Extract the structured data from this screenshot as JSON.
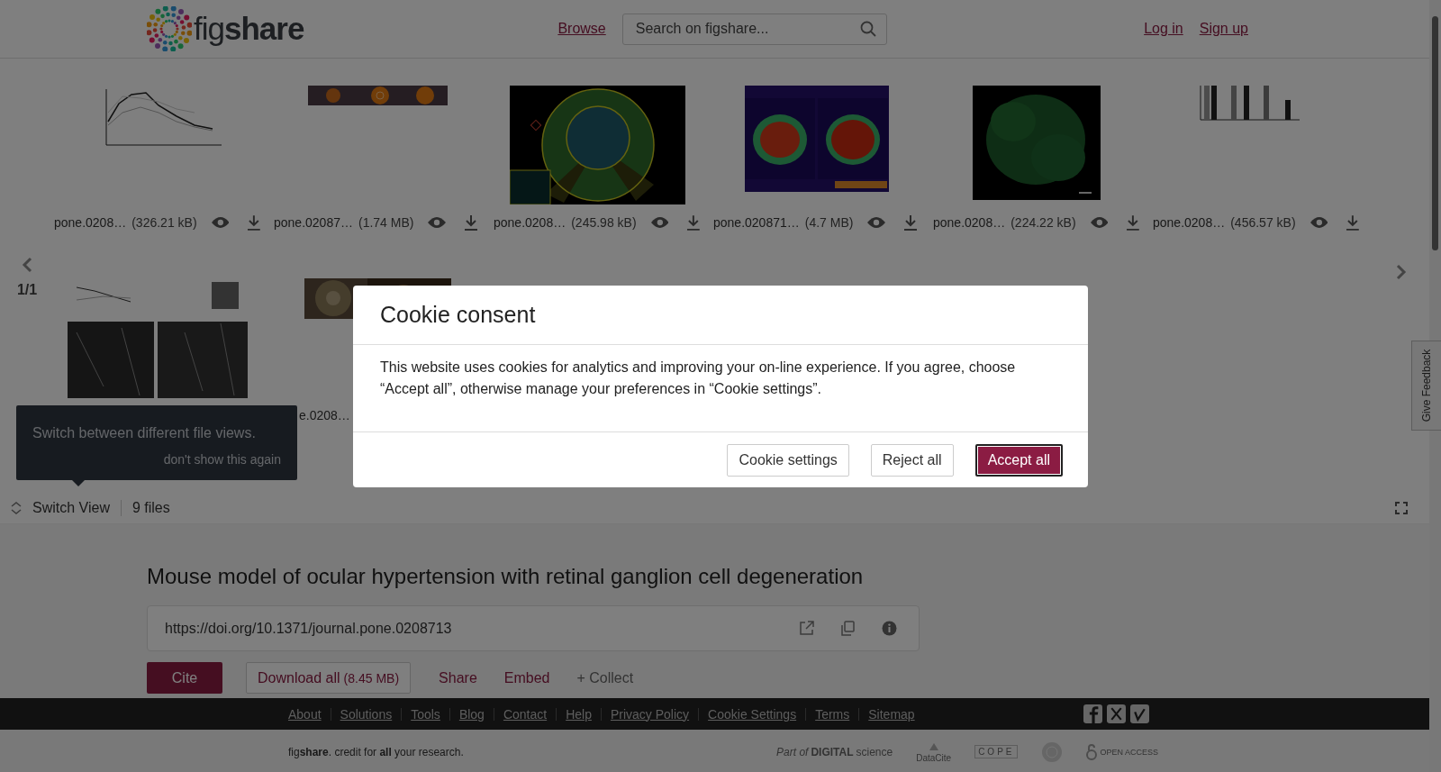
{
  "header": {
    "logo": "fig**share**",
    "nav_link": "Browse",
    "search": {
      "placeholder": "Search on figshare..."
    },
    "links": [
      "Log in",
      "Sign up"
    ]
  },
  "gallery": {
    "page": "1/1",
    "rows": [
      {
        "files": [
          {
            "kind": "picture",
            "name": "pone.0208…",
            "size": "(326.21 kB)"
          },
          {
            "kind": "picture",
            "name": "pone.02087…",
            "size": "(1.74 MB)"
          },
          {
            "kind": "picture",
            "name": "pone.0208…",
            "size": "(245.98 kB)"
          },
          {
            "kind": "picture",
            "name": "pone.020871…",
            "size": "(4.7 MB)"
          },
          {
            "kind": "picture",
            "name": "pone.0208…",
            "size": "(224.22 kB)"
          },
          {
            "kind": "picture",
            "name": "pone.0208…",
            "size": "(456.57 kB)"
          }
        ]
      },
      {
        "files": [
          {
            "kind": "picture"
          },
          {
            "kind": "picture",
            "name": "e.0208…"
          }
        ]
      }
    ]
  },
  "tooltip": {
    "text": "Switch between different file views.",
    "dismiss": "don't show this again"
  },
  "switch_bar": {
    "label": "Switch View",
    "file_count": "9 files"
  },
  "item": {
    "title": "Mouse model of ocular hypertension with retinal ganglion cell degeneration",
    "doi": "https://doi.org/10.1371/journal.pone.0208713",
    "actions": [
      {
        "kind": "primary",
        "label": "Cite"
      },
      {
        "kind": "outlined",
        "label": "Download all",
        "note": "(8.45 MB)"
      },
      {
        "kind": "link",
        "label": "Share"
      },
      {
        "kind": "link",
        "label": "Embed"
      },
      {
        "kind": "muted",
        "label": "+ Collect"
      }
    ]
  },
  "footer": {
    "links": [
      "About",
      "Solutions",
      "Tools",
      "Blog",
      "Contact",
      "Help",
      "Privacy Policy",
      "Cookie Settings",
      "Terms",
      "Sitemap"
    ],
    "social": [
      {
        "kind": "facebook"
      },
      {
        "kind": "x"
      },
      {
        "kind": "vimeo"
      }
    ],
    "tagline": "fig**share**. credit for **all** your research.",
    "partners": [
      {
        "kind": "digital-science",
        "label": "*Part of* **DIGITAL**science"
      },
      {
        "kind": "datacite",
        "label": "DataCite"
      },
      {
        "kind": "cope",
        "label": "COPE"
      },
      {
        "kind": "emblem"
      },
      {
        "kind": "open-access",
        "label": "OPEN ACCESS"
      }
    ]
  },
  "feedback": "Give Feedback",
  "cookie_modal": {
    "title": "Cookie consent",
    "body": "This website uses cookies for analytics and improving your on-line experience. If you agree, choose “Accept all”, otherwise manage your preferences in “Cookie settings”.",
    "buttons": [
      {
        "kind": "secondary",
        "label": "Cookie settings",
        "focused": false
      },
      {
        "kind": "secondary",
        "label": "Reject all",
        "focused": false
      },
      {
        "kind": "primary",
        "label": "Accept all",
        "focused": true
      }
    ]
  }
}
